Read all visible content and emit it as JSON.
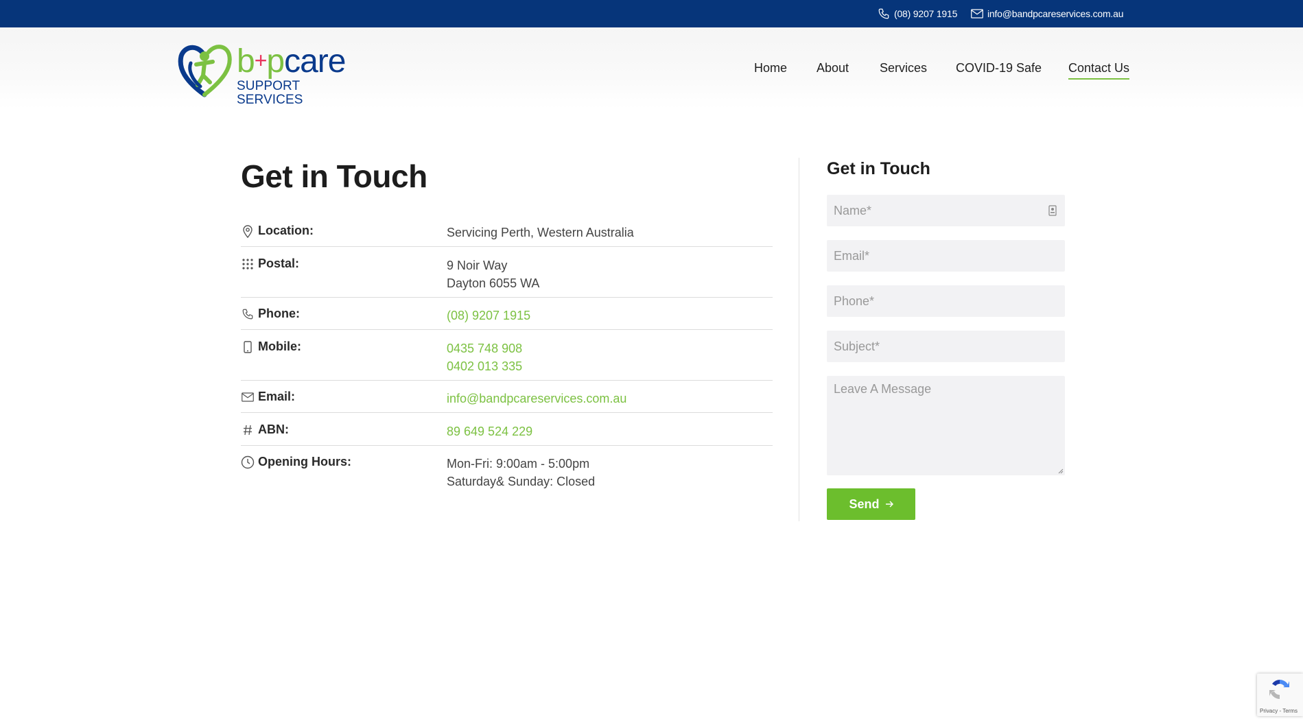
{
  "topbar": {
    "phone": "(08) 9207 1915",
    "email": "info@bandpcareservices.com.au"
  },
  "logo": {
    "b": "b",
    "plus": "+",
    "p": "p",
    "care": "care",
    "sub": "SUPPORT SERVICES"
  },
  "nav": {
    "items": [
      "Home",
      "About",
      "Services",
      "COVID-19 Safe",
      "Contact Us"
    ],
    "active": "Contact Us"
  },
  "main": {
    "title": "Get in Touch",
    "rows": [
      {
        "icon": "location-pin-icon",
        "label": "Location:",
        "lines": [
          "Servicing Perth, Western Australia"
        ]
      },
      {
        "icon": "grid-dots-icon",
        "label": "Postal:",
        "lines": [
          "9 Noir Way",
          "Dayton 6055 WA"
        ]
      },
      {
        "icon": "phone-icon",
        "label": "Phone:",
        "lines": [
          "(08) 9207 1915"
        ]
      },
      {
        "icon": "mobile-icon",
        "label": "Mobile:",
        "lines": [
          "0435 748 908",
          "0402 013 335"
        ]
      },
      {
        "icon": "envelope-icon",
        "label": "Email:",
        "lines": [
          "info@bandpcareservices.com.au"
        ]
      },
      {
        "icon": "hash-icon",
        "label": "ABN:",
        "lines": [
          "89 649 524 229"
        ]
      },
      {
        "icon": "clock-icon",
        "label": "Opening Hours:",
        "lines": [
          "Mon-Fri: 9:00am - 5:00pm",
          "Saturday& Sunday: Closed"
        ]
      }
    ]
  },
  "form": {
    "title": "Get in Touch",
    "name_placeholder": "Name*",
    "email_placeholder": "Email*",
    "phone_placeholder": "Phone*",
    "subject_placeholder": "Subject*",
    "message_placeholder": "Leave A Message",
    "send_label": "Send"
  },
  "recaptcha": {
    "text": "Privacy - Terms"
  },
  "colors": {
    "topbar": "#06357a",
    "accent_green": "#7cc142",
    "button_green": "#6cbe2d",
    "brand_blue": "#0a3a8c"
  }
}
